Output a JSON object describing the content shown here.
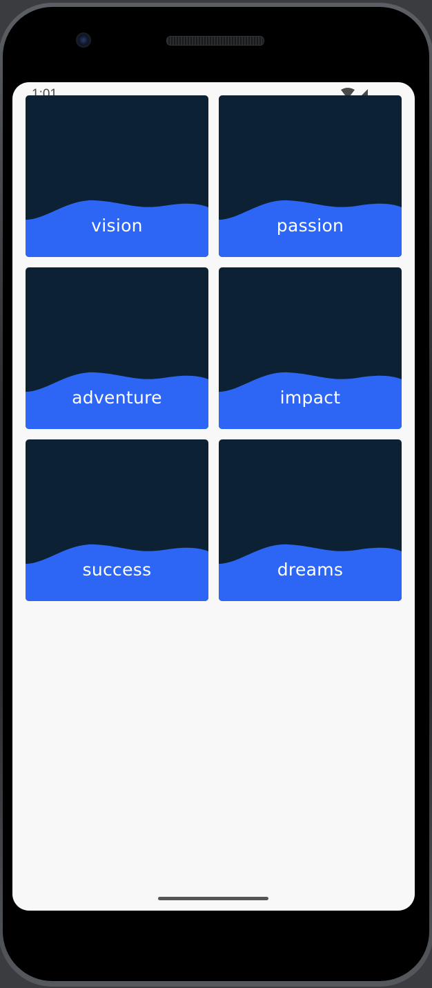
{
  "status_bar": {
    "time": "1:01",
    "wifi_icon": "wifi-icon",
    "signal_icon": "cell-signal-icon"
  },
  "tiles": [
    {
      "label": "vision"
    },
    {
      "label": "passion"
    },
    {
      "label": "adventure"
    },
    {
      "label": "impact"
    },
    {
      "label": "success"
    },
    {
      "label": "dreams"
    }
  ],
  "colors": {
    "tile_background": "#0c2133",
    "wave": "#2d66f5",
    "screen_background": "#f8f8f9",
    "label_text": "#ffffff"
  }
}
